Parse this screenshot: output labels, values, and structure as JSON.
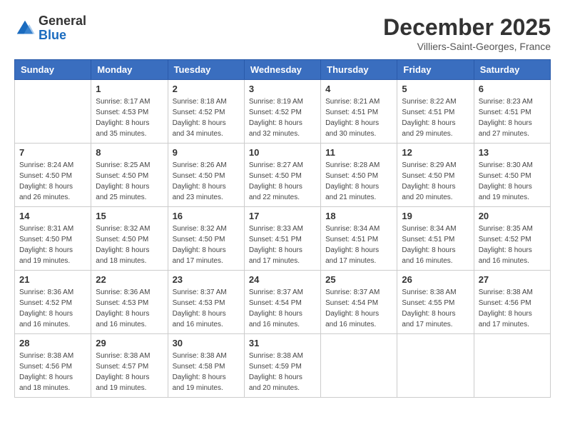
{
  "header": {
    "logo_general": "General",
    "logo_blue": "Blue",
    "month_title": "December 2025",
    "location": "Villiers-Saint-Georges, France"
  },
  "days_of_week": [
    "Sunday",
    "Monday",
    "Tuesday",
    "Wednesday",
    "Thursday",
    "Friday",
    "Saturday"
  ],
  "weeks": [
    [
      {
        "day": "",
        "info": ""
      },
      {
        "day": "1",
        "info": "Sunrise: 8:17 AM\nSunset: 4:53 PM\nDaylight: 8 hours\nand 35 minutes."
      },
      {
        "day": "2",
        "info": "Sunrise: 8:18 AM\nSunset: 4:52 PM\nDaylight: 8 hours\nand 34 minutes."
      },
      {
        "day": "3",
        "info": "Sunrise: 8:19 AM\nSunset: 4:52 PM\nDaylight: 8 hours\nand 32 minutes."
      },
      {
        "day": "4",
        "info": "Sunrise: 8:21 AM\nSunset: 4:51 PM\nDaylight: 8 hours\nand 30 minutes."
      },
      {
        "day": "5",
        "info": "Sunrise: 8:22 AM\nSunset: 4:51 PM\nDaylight: 8 hours\nand 29 minutes."
      },
      {
        "day": "6",
        "info": "Sunrise: 8:23 AM\nSunset: 4:51 PM\nDaylight: 8 hours\nand 27 minutes."
      }
    ],
    [
      {
        "day": "7",
        "info": "Sunrise: 8:24 AM\nSunset: 4:50 PM\nDaylight: 8 hours\nand 26 minutes."
      },
      {
        "day": "8",
        "info": "Sunrise: 8:25 AM\nSunset: 4:50 PM\nDaylight: 8 hours\nand 25 minutes."
      },
      {
        "day": "9",
        "info": "Sunrise: 8:26 AM\nSunset: 4:50 PM\nDaylight: 8 hours\nand 23 minutes."
      },
      {
        "day": "10",
        "info": "Sunrise: 8:27 AM\nSunset: 4:50 PM\nDaylight: 8 hours\nand 22 minutes."
      },
      {
        "day": "11",
        "info": "Sunrise: 8:28 AM\nSunset: 4:50 PM\nDaylight: 8 hours\nand 21 minutes."
      },
      {
        "day": "12",
        "info": "Sunrise: 8:29 AM\nSunset: 4:50 PM\nDaylight: 8 hours\nand 20 minutes."
      },
      {
        "day": "13",
        "info": "Sunrise: 8:30 AM\nSunset: 4:50 PM\nDaylight: 8 hours\nand 19 minutes."
      }
    ],
    [
      {
        "day": "14",
        "info": "Sunrise: 8:31 AM\nSunset: 4:50 PM\nDaylight: 8 hours\nand 19 minutes."
      },
      {
        "day": "15",
        "info": "Sunrise: 8:32 AM\nSunset: 4:50 PM\nDaylight: 8 hours\nand 18 minutes."
      },
      {
        "day": "16",
        "info": "Sunrise: 8:32 AM\nSunset: 4:50 PM\nDaylight: 8 hours\nand 17 minutes."
      },
      {
        "day": "17",
        "info": "Sunrise: 8:33 AM\nSunset: 4:51 PM\nDaylight: 8 hours\nand 17 minutes."
      },
      {
        "day": "18",
        "info": "Sunrise: 8:34 AM\nSunset: 4:51 PM\nDaylight: 8 hours\nand 17 minutes."
      },
      {
        "day": "19",
        "info": "Sunrise: 8:34 AM\nSunset: 4:51 PM\nDaylight: 8 hours\nand 16 minutes."
      },
      {
        "day": "20",
        "info": "Sunrise: 8:35 AM\nSunset: 4:52 PM\nDaylight: 8 hours\nand 16 minutes."
      }
    ],
    [
      {
        "day": "21",
        "info": "Sunrise: 8:36 AM\nSunset: 4:52 PM\nDaylight: 8 hours\nand 16 minutes."
      },
      {
        "day": "22",
        "info": "Sunrise: 8:36 AM\nSunset: 4:53 PM\nDaylight: 8 hours\nand 16 minutes."
      },
      {
        "day": "23",
        "info": "Sunrise: 8:37 AM\nSunset: 4:53 PM\nDaylight: 8 hours\nand 16 minutes."
      },
      {
        "day": "24",
        "info": "Sunrise: 8:37 AM\nSunset: 4:54 PM\nDaylight: 8 hours\nand 16 minutes."
      },
      {
        "day": "25",
        "info": "Sunrise: 8:37 AM\nSunset: 4:54 PM\nDaylight: 8 hours\nand 16 minutes."
      },
      {
        "day": "26",
        "info": "Sunrise: 8:38 AM\nSunset: 4:55 PM\nDaylight: 8 hours\nand 17 minutes."
      },
      {
        "day": "27",
        "info": "Sunrise: 8:38 AM\nSunset: 4:56 PM\nDaylight: 8 hours\nand 17 minutes."
      }
    ],
    [
      {
        "day": "28",
        "info": "Sunrise: 8:38 AM\nSunset: 4:56 PM\nDaylight: 8 hours\nand 18 minutes."
      },
      {
        "day": "29",
        "info": "Sunrise: 8:38 AM\nSunset: 4:57 PM\nDaylight: 8 hours\nand 19 minutes."
      },
      {
        "day": "30",
        "info": "Sunrise: 8:38 AM\nSunset: 4:58 PM\nDaylight: 8 hours\nand 19 minutes."
      },
      {
        "day": "31",
        "info": "Sunrise: 8:38 AM\nSunset: 4:59 PM\nDaylight: 8 hours\nand 20 minutes."
      },
      {
        "day": "",
        "info": ""
      },
      {
        "day": "",
        "info": ""
      },
      {
        "day": "",
        "info": ""
      }
    ]
  ]
}
